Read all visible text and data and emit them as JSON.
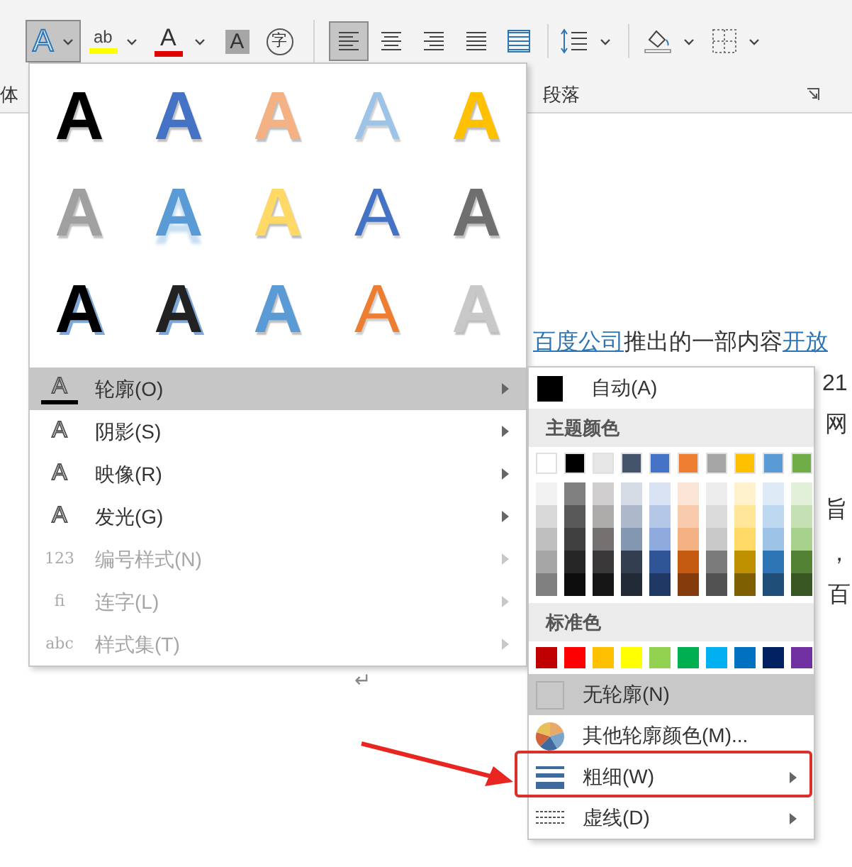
{
  "ribbon": {
    "font_group_label": "体",
    "paragraph_group_label": "段落",
    "text_effects_button": {
      "glyph": "A",
      "selected": true
    },
    "highlight_button": {
      "glyph": "ab"
    },
    "font_color_button": {
      "glyph": "A"
    },
    "shading_button": {
      "glyph": "A"
    },
    "enclose_button": {
      "glyph": "字"
    },
    "align_buttons": [
      {
        "kind": "left",
        "selected": true
      },
      {
        "kind": "center",
        "selected": false
      },
      {
        "kind": "right",
        "selected": false
      },
      {
        "kind": "justify",
        "selected": false
      },
      {
        "kind": "distribute",
        "selected": false
      }
    ]
  },
  "document": {
    "lines": [
      {
        "parts": [
          {
            "text": "百度公司",
            "link": true
          },
          {
            "text": "推出的一部内容",
            "link": false
          },
          {
            "text": "开放",
            "link": true
          }
        ]
      },
      {
        "parts": [
          {
            "text": "21",
            "link": false
          }
        ]
      },
      {
        "parts": [
          {
            "text": "网",
            "link": false
          }
        ]
      },
      {
        "parts": [
          {
            "text": "旨",
            "link": false
          }
        ]
      },
      {
        "parts": [
          {
            "text": "，",
            "link": false
          }
        ]
      },
      {
        "parts": [
          {
            "text": "百",
            "link": false
          }
        ]
      }
    ],
    "paragraph_mark": "↵"
  },
  "text_effects_menu": {
    "gallery": [
      {
        "glyph": "A",
        "color": "#000000",
        "kind": "fill"
      },
      {
        "glyph": "A",
        "color": "#4472c4",
        "kind": "fill"
      },
      {
        "glyph": "A",
        "color": "#f4b183",
        "kind": "fill"
      },
      {
        "glyph": "A",
        "color": "#9dc3e6",
        "kind": "outline"
      },
      {
        "glyph": "A",
        "color": "#ffc000",
        "kind": "fill"
      },
      {
        "glyph": "A",
        "color": "#a0a0a0",
        "kind": "fill"
      },
      {
        "glyph": "A",
        "color": "#5b9bd5",
        "kind": "reflection"
      },
      {
        "glyph": "A",
        "color": "#ffd966",
        "kind": "fill"
      },
      {
        "glyph": "A",
        "color": "#4472c4",
        "kind": "outline"
      },
      {
        "glyph": "A",
        "color": "#6f6f6f",
        "kind": "fill"
      },
      {
        "glyph": "A",
        "color": "#000000",
        "kind": "shadow"
      },
      {
        "glyph": "A",
        "color": "#222222",
        "kind": "shadow"
      },
      {
        "glyph": "A",
        "color": "#5b9bd5",
        "kind": "fill"
      },
      {
        "glyph": "A",
        "color": "#ed7d31",
        "kind": "outline"
      },
      {
        "glyph": "A",
        "color": "#c8c8c8",
        "kind": "fill"
      }
    ],
    "items": [
      {
        "icon": "A",
        "label": "轮廓(O)",
        "highlighted": true,
        "disabled": false
      },
      {
        "icon": "A",
        "label": "阴影(S)",
        "highlighted": false,
        "disabled": false
      },
      {
        "icon": "A",
        "label": "映像(R)",
        "highlighted": false,
        "disabled": false
      },
      {
        "icon": "A",
        "label": "发光(G)",
        "highlighted": false,
        "disabled": false
      },
      {
        "icon": "123",
        "label": "编号样式(N)",
        "highlighted": false,
        "disabled": true
      },
      {
        "icon": "fi",
        "label": "连字(L)",
        "highlighted": false,
        "disabled": true
      },
      {
        "icon": "abc",
        "label": "样式集(T)",
        "highlighted": false,
        "disabled": true
      }
    ]
  },
  "outline_submenu": {
    "auto_label": "自动(A)",
    "theme_header": "主题颜色",
    "theme_colors": [
      {
        "color": "#ffffff",
        "shades": [
          {
            "color": "#f2f2f2"
          },
          {
            "color": "#d9d9d9"
          },
          {
            "color": "#bfbfbf"
          },
          {
            "color": "#a6a6a6"
          },
          {
            "color": "#808080"
          }
        ]
      },
      {
        "color": "#000000",
        "shades": [
          {
            "color": "#808080"
          },
          {
            "color": "#595959"
          },
          {
            "color": "#404040"
          },
          {
            "color": "#262626"
          },
          {
            "color": "#0d0d0d"
          }
        ]
      },
      {
        "color": "#e7e6e6",
        "shades": [
          {
            "color": "#d0cece"
          },
          {
            "color": "#aeabab"
          },
          {
            "color": "#757171"
          },
          {
            "color": "#3a3838"
          },
          {
            "color": "#171616"
          }
        ]
      },
      {
        "color": "#44546a",
        "shades": [
          {
            "color": "#d6dce5"
          },
          {
            "color": "#adb9ca"
          },
          {
            "color": "#8497b0"
          },
          {
            "color": "#333f50"
          },
          {
            "color": "#222a35"
          }
        ]
      },
      {
        "color": "#4472c4",
        "shades": [
          {
            "color": "#dae3f3"
          },
          {
            "color": "#b4c7e7"
          },
          {
            "color": "#8faadc"
          },
          {
            "color": "#2f5597"
          },
          {
            "color": "#203864"
          }
        ]
      },
      {
        "color": "#ed7d31",
        "shades": [
          {
            "color": "#fbe5d6"
          },
          {
            "color": "#f8cbad"
          },
          {
            "color": "#f4b183"
          },
          {
            "color": "#c55a11"
          },
          {
            "color": "#843c0c"
          }
        ]
      },
      {
        "color": "#a5a5a5",
        "shades": [
          {
            "color": "#ededed"
          },
          {
            "color": "#dbdbdb"
          },
          {
            "color": "#c9c9c9"
          },
          {
            "color": "#7b7b7b"
          },
          {
            "color": "#525252"
          }
        ]
      },
      {
        "color": "#ffc000",
        "shades": [
          {
            "color": "#fff2cc"
          },
          {
            "color": "#ffe699"
          },
          {
            "color": "#ffd966"
          },
          {
            "color": "#bf9000"
          },
          {
            "color": "#7f6000"
          }
        ]
      },
      {
        "color": "#5b9bd5",
        "shades": [
          {
            "color": "#deebf7"
          },
          {
            "color": "#bdd7ee"
          },
          {
            "color": "#9dc3e6"
          },
          {
            "color": "#2e75b6"
          },
          {
            "color": "#1f4e79"
          }
        ]
      },
      {
        "color": "#70ad47",
        "shades": [
          {
            "color": "#e2f0d9"
          },
          {
            "color": "#c5e0b4"
          },
          {
            "color": "#a9d18e"
          },
          {
            "color": "#548235"
          },
          {
            "color": "#385723"
          }
        ]
      }
    ],
    "standard_header": "标准色",
    "standard_colors": [
      {
        "color": "#c00000"
      },
      {
        "color": "#ff0000"
      },
      {
        "color": "#ffc000"
      },
      {
        "color": "#ffff00"
      },
      {
        "color": "#92d050"
      },
      {
        "color": "#00b050"
      },
      {
        "color": "#00b0f0"
      },
      {
        "color": "#0070c0"
      },
      {
        "color": "#002060"
      },
      {
        "color": "#7030a0"
      }
    ],
    "items": [
      {
        "kind": "none",
        "label": "无轮廓(N)",
        "highlighted": true,
        "submenu": false
      },
      {
        "kind": "more",
        "label": "其他轮廓颜色(M)...",
        "highlighted": false,
        "submenu": false
      },
      {
        "kind": "weight",
        "label": "粗细(W)",
        "highlighted": false,
        "submenu": true
      },
      {
        "kind": "dash",
        "label": "虚线(D)",
        "highlighted": false,
        "submenu": true
      }
    ]
  }
}
